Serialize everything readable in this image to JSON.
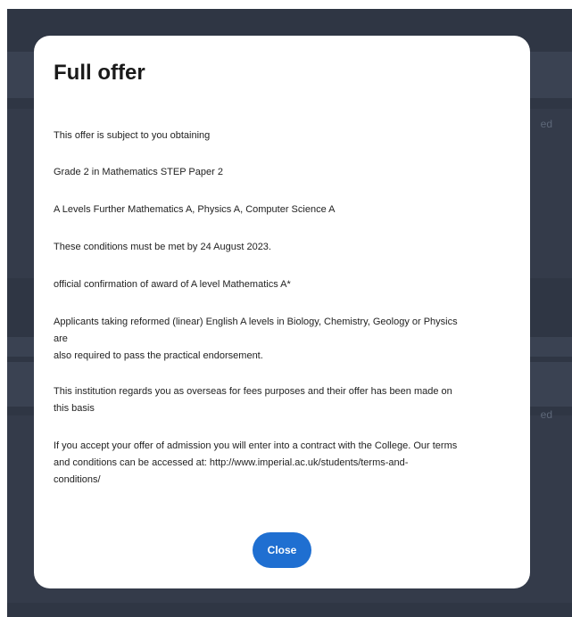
{
  "background": {
    "ghost_text_1": "ed",
    "ghost_text_2": "ed"
  },
  "modal": {
    "title": "Full offer",
    "paragraphs": [
      "This offer is subject to you obtaining",
      "Grade 2 in Mathematics STEP Paper 2",
      "A Levels Further Mathematics  A, Physics A, Computer Science  A",
      "These conditions must be met by 24 August 2023.",
      "official confirmation of award of A level Mathematics A*",
      "Applicants taking reformed (linear) English A levels in Biology, Chemistry, Geology or Physics",
      "are",
      "also required to pass the practical endorsement.",
      "This institution regards you as overseas for fees purposes and their offer has been made on",
      "this basis",
      "If you accept your offer of admission you will enter into a contract with the College. Our terms",
      "and conditions can be accessed at: http://www.imperial.ac.uk/students/terms-and-",
      "conditions/"
    ],
    "close_label": "Close"
  },
  "colors": {
    "backdrop": "#2f3644",
    "modal_bg": "#ffffff",
    "button_bg": "#1f6fd1",
    "button_text": "#ffffff"
  }
}
